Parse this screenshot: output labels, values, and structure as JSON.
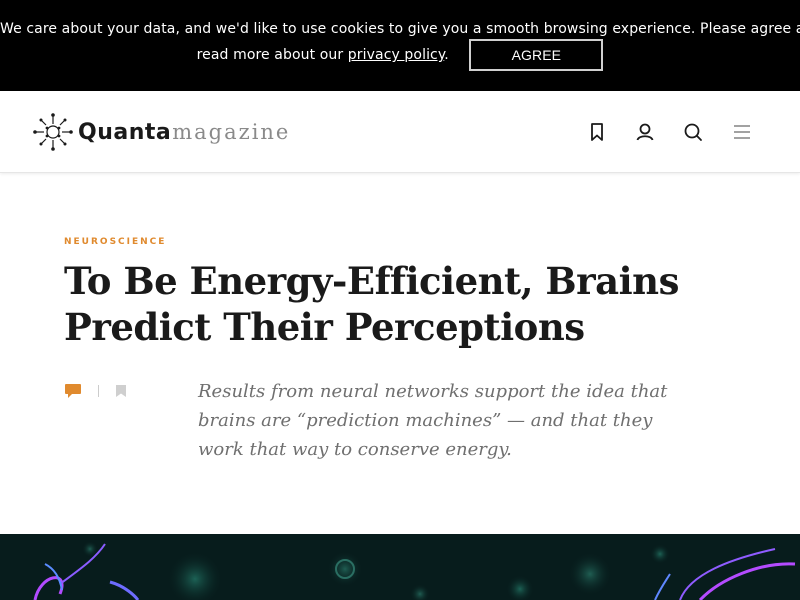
{
  "cookie_banner": {
    "line1": "We care about your data, and we'd like to use cookies to give you a smooth browsing experience. Please agree and",
    "line2_prefix": "read more about our ",
    "link_text": "privacy policy",
    "line2_suffix": ".",
    "agree_label": "AGREE"
  },
  "header": {
    "logo_word": "Quanta",
    "logo_sub": "magazine",
    "icons": [
      "bookmark-icon",
      "user-icon",
      "search-icon",
      "menu-icon"
    ]
  },
  "article": {
    "kicker": "NEUROSCIENCE",
    "headline": "To Be Energy-Efficient, Brains Predict Their Perceptions",
    "dek": "Results from neural networks support the idea that brains are “prediction machines” — and that they work that way to conserve energy.",
    "meta_icons": [
      "comment-icon",
      "bookmark-icon"
    ]
  },
  "colors": {
    "banner_bg": "#000000",
    "accent_orange": "#e08a2e",
    "headline": "#1a1a1a",
    "dek": "#6f6f6f",
    "hero_bg": "#071c1c"
  }
}
